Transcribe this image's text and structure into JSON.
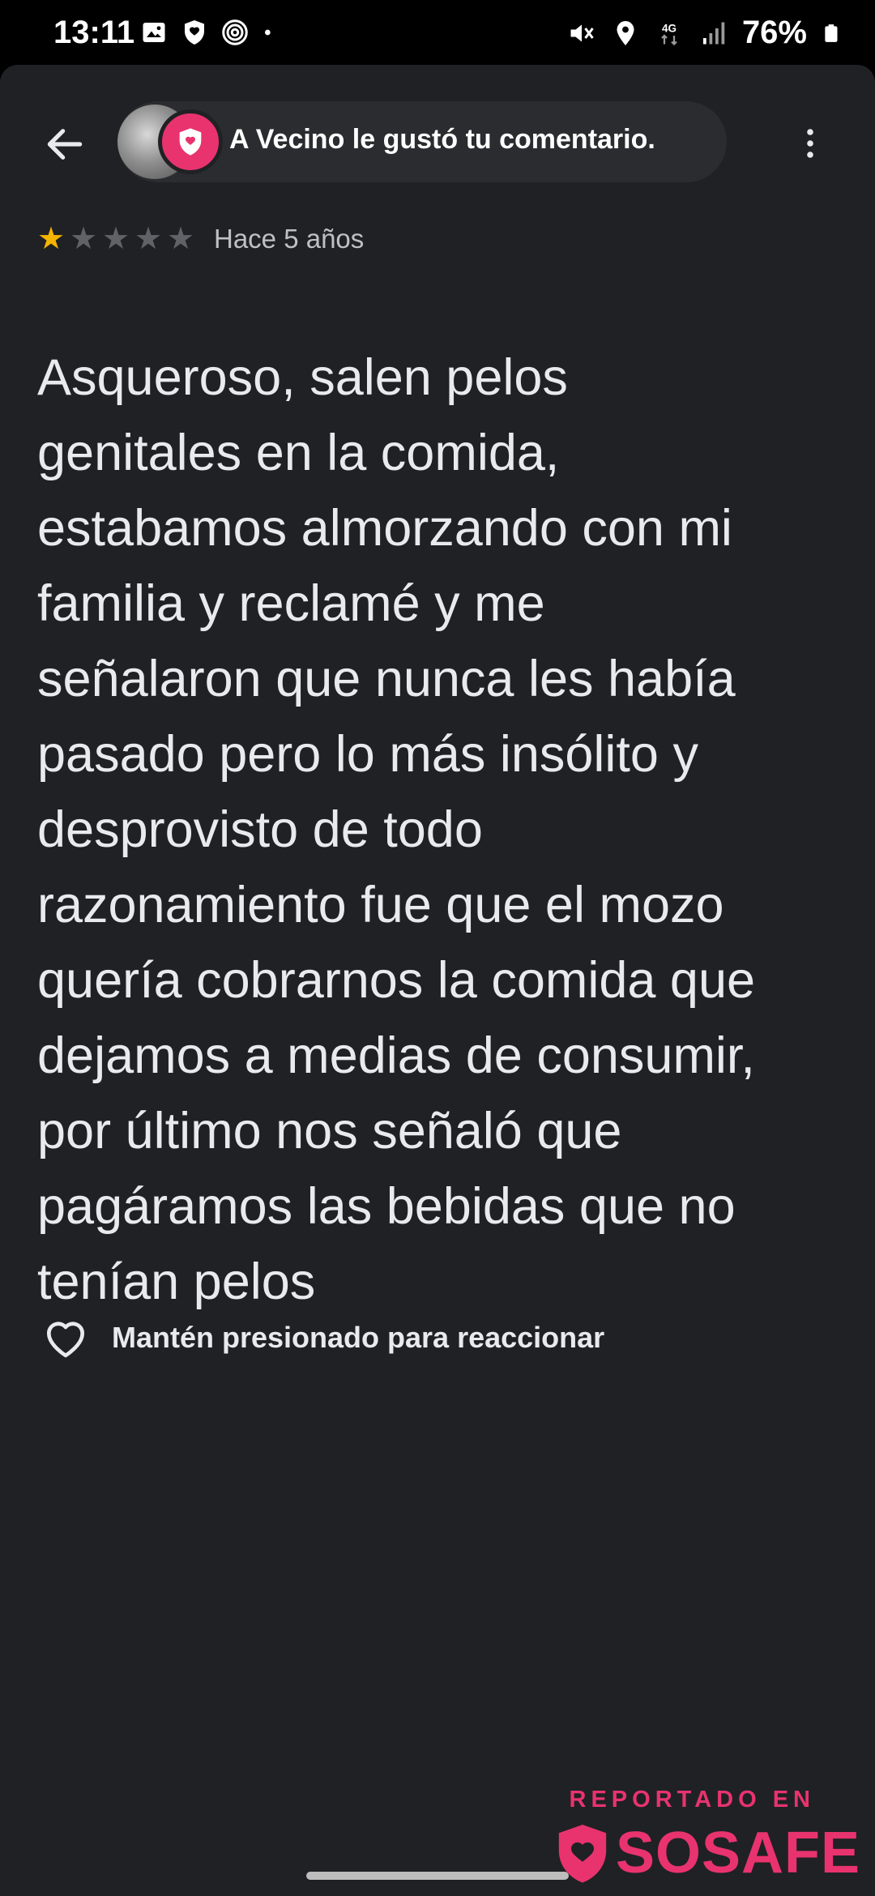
{
  "status_bar": {
    "time": "13:11",
    "battery": "76%",
    "network": "4G",
    "left_icons": [
      "image-icon",
      "shield-icon",
      "at-sign-icon",
      "dot-icon"
    ],
    "right_icons": [
      "mute-vibrate-icon",
      "location-icon",
      "4g-data-icon",
      "signal-icon",
      "battery-icon"
    ]
  },
  "header": {
    "notification": "A Vecino le gustó tu comentario.",
    "back_icon": "arrow-left-icon",
    "menu_icon": "more-vertical-icon"
  },
  "review": {
    "rating": 1,
    "max_rating": 5,
    "time_ago": "Hace 5 años",
    "lines": [
      "Asqueroso, salen pelos",
      "genitales en la comida,",
      "estabamos almorzando con mi",
      "familia y reclamé y me",
      "señalaron que nunca les había",
      "pasado pero lo más insólito y",
      "desprovisto de todo",
      "razonamiento fue que el mozo",
      "quería cobrarnos la comida que",
      "dejamos a medias de consumir,",
      "por último nos señaló que",
      "pagáramos las bebidas que no",
      "tenían pelos"
    ]
  },
  "reaction": {
    "label": "Mantén presionado para reaccionar",
    "icon": "heart-outline-icon"
  },
  "watermark": {
    "top": "REPORTADO EN",
    "brand": "SOSAFE"
  },
  "colors": {
    "background": "#202124",
    "star_active": "#f5b400",
    "star_inactive": "#5f6368",
    "brand_pink": "#e8336f"
  }
}
